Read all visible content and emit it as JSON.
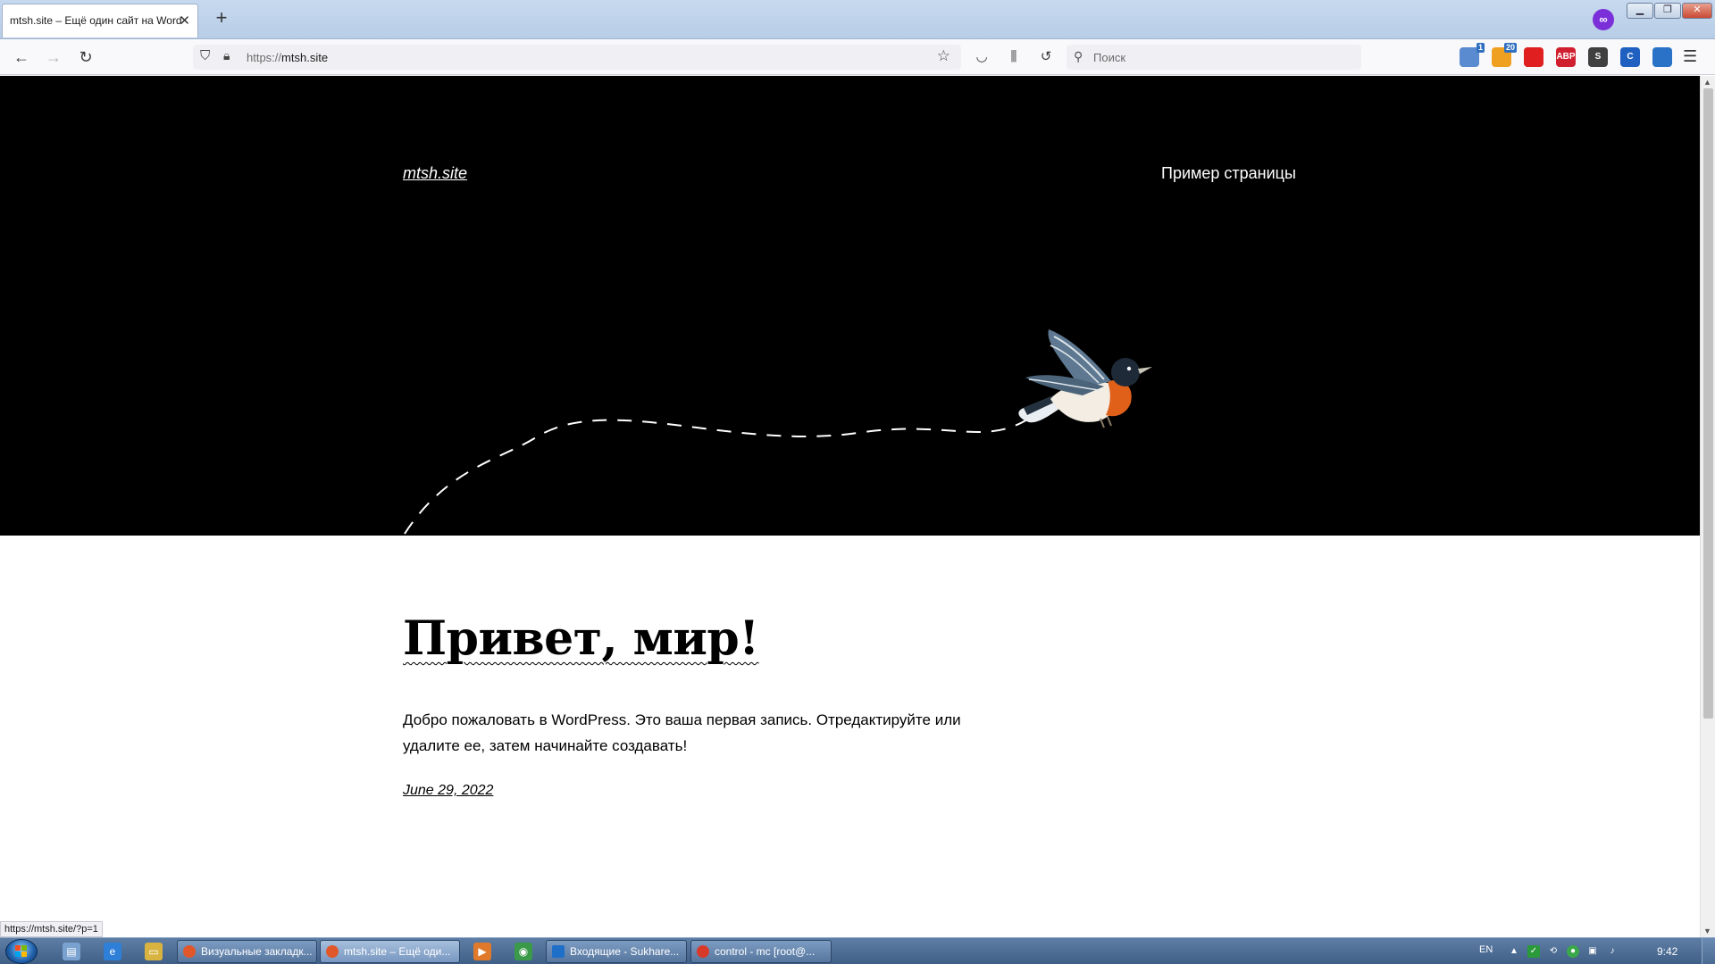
{
  "browser": {
    "tab": {
      "title": "mtsh.site – Ещё один сайт на WordPress",
      "close": "✕"
    },
    "new_tab": "+",
    "url_protocol": "https://",
    "url_host": "mtsh.site",
    "search_placeholder": "Поиск",
    "extensions": [
      {
        "name": "mail-extension",
        "badge": "1",
        "color": "#5a8ad0"
      },
      {
        "name": "weather-extension",
        "badge": "20",
        "color": "#f0a020"
      },
      {
        "name": "bookmark-extension",
        "badge": "",
        "color": "#e02020"
      },
      {
        "name": "adblock-extension",
        "label": "ABP",
        "color": "#d02030"
      },
      {
        "name": "s-extension",
        "label": "S",
        "color": "#404040"
      },
      {
        "name": "c-extension",
        "label": "C",
        "color": "#2060c0"
      },
      {
        "name": "chat-extension",
        "label": "",
        "color": "#2a72c8"
      }
    ]
  },
  "site": {
    "title": "mtsh.site",
    "nav_item": "Пример страницы"
  },
  "post": {
    "title": "Привет, мир!",
    "body": "Добро пожаловать в WordPress. Это ваша первая запись. Отредактируйте или удалите ее, затем начинайте создавать!",
    "date": "June 29, 2022"
  },
  "status_url": "https://mtsh.site/?p=1",
  "taskbar": {
    "tasks": [
      {
        "label": "Визуальные закладк...",
        "icon_color": "#e0582a",
        "active": false
      },
      {
        "label": "mtsh.site – Ещё оди...",
        "icon_color": "#e0582a",
        "active": true
      },
      {
        "label": "Входящие - Sukhare...",
        "icon_color": "#1e6fc8",
        "active": false
      },
      {
        "label": "control - mc [root@...",
        "icon_color": "#d83a2a",
        "active": false
      }
    ],
    "language": "EN",
    "time": "9:42"
  },
  "colors": {
    "hero_background": "#000000",
    "page_background": "#ffffff",
    "bird_breast": "#e0601a"
  }
}
